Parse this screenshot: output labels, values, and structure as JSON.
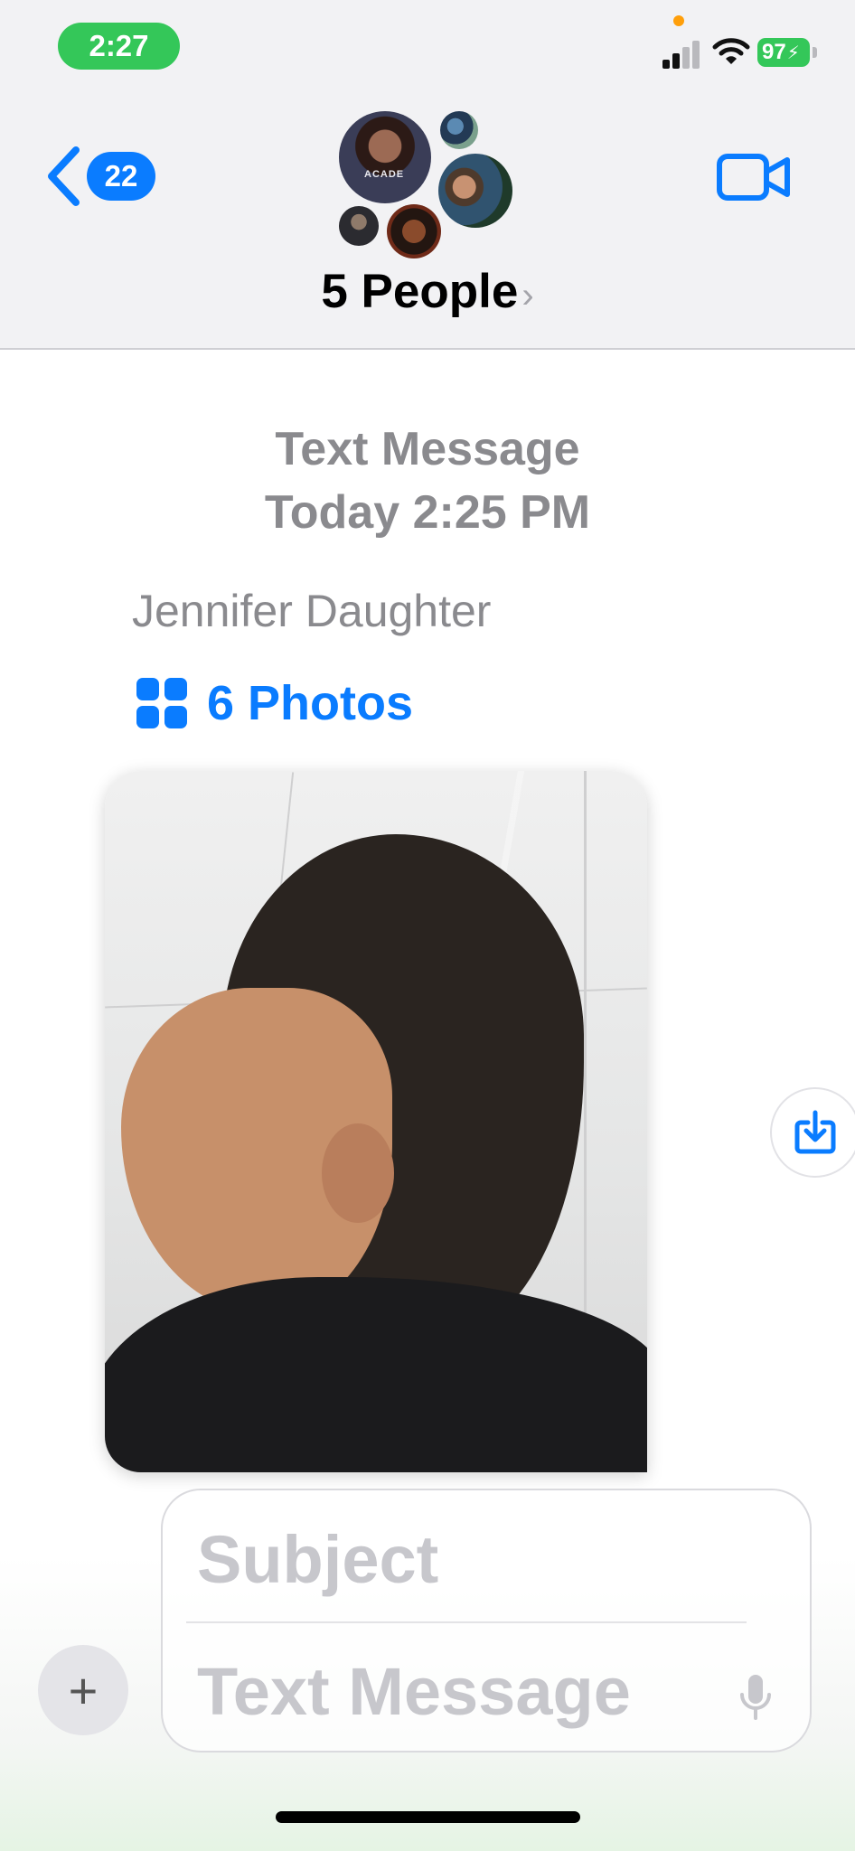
{
  "status_bar": {
    "time": "2:27",
    "battery": "97",
    "battery_color": "#34c759"
  },
  "nav": {
    "back_count": "22",
    "title": "5 People",
    "title_chevron": "›",
    "accent": "#0a7cff"
  },
  "avatars": {
    "av1_text": "ACADE"
  },
  "message": {
    "service": "Text Message",
    "timestamp": "Today 2:25 PM",
    "sender": "Jennifer Daughter",
    "photos_label": "6 Photos"
  },
  "icons": {
    "back": "chevron-left-icon",
    "video": "video-camera-icon",
    "grid": "grid-icon",
    "save": "save-download-icon",
    "plus": "plus-icon",
    "mic": "microphone-icon"
  },
  "composer": {
    "plus_label": "+",
    "subject_placeholder": "Subject",
    "text_placeholder": "Text Message"
  }
}
